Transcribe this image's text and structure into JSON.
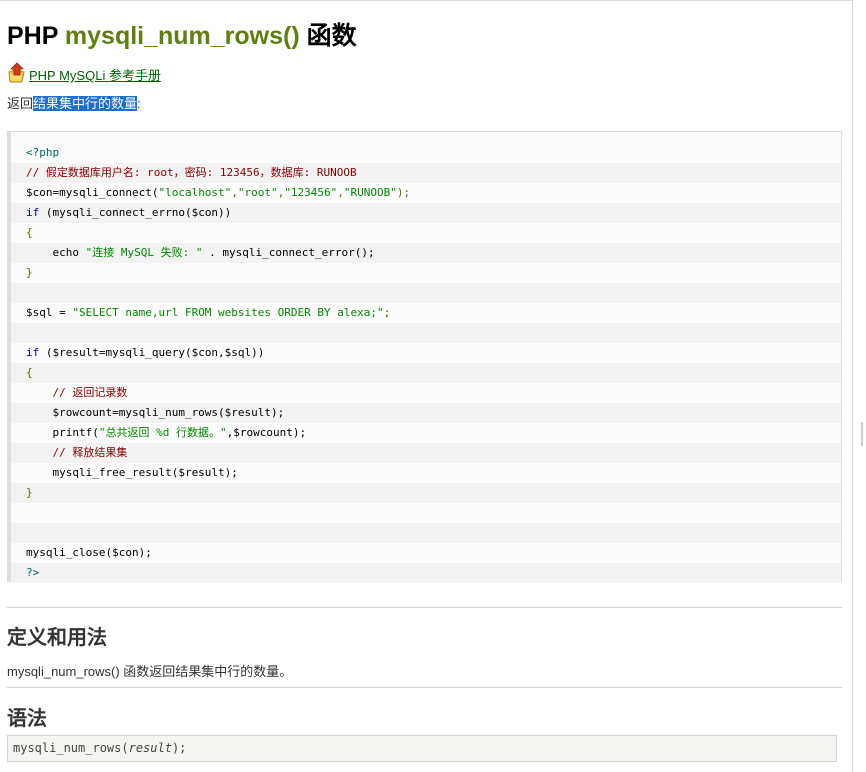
{
  "title": {
    "prefix": "PHP ",
    "function": "mysqli_num_rows()",
    "suffix": " 函数"
  },
  "reference_link": {
    "label": " PHP MySQLi 参考手册",
    "icon": "arrow-up-folder-icon"
  },
  "intro": {
    "prefix": "返回",
    "highlight": "结果集中行的数量",
    "suffix": ":"
  },
  "code_lines": [
    [
      {
        "t": "&lt;?php",
        "c": "c-tag"
      }
    ],
    [
      {
        "t": "// 假定数据库用户名: root，密码: 123456，数据库: RUNOOB",
        "c": "c-com"
      }
    ],
    [
      {
        "t": "$con=mysqli_connect(",
        "c": ""
      },
      {
        "t": "\"localhost\"",
        "c": "c-str"
      },
      {
        "t": ",",
        "c": "c-pun"
      },
      {
        "t": "\"root\"",
        "c": "c-str"
      },
      {
        "t": ",",
        "c": "c-pun"
      },
      {
        "t": "\"123456\"",
        "c": "c-str"
      },
      {
        "t": ",",
        "c": "c-pun"
      },
      {
        "t": "\"RUNOOB\"",
        "c": "c-str"
      },
      {
        "t": ");",
        "c": "c-pun"
      }
    ],
    [
      {
        "t": "if",
        "c": "c-kw"
      },
      {
        "t": " (mysqli_connect_errno($con))",
        "c": ""
      }
    ],
    [
      {
        "t": "{",
        "c": "c-pun"
      }
    ],
    [
      {
        "t": "    echo ",
        "c": ""
      },
      {
        "t": "\"连接 MySQL 失败: \"",
        "c": "c-str"
      },
      {
        "t": " . mysqli_connect_error();",
        "c": ""
      }
    ],
    [
      {
        "t": "}",
        "c": "c-pun"
      }
    ],
    [
      {
        "t": "",
        "c": ""
      }
    ],
    [
      {
        "t": "$sql = ",
        "c": ""
      },
      {
        "t": "\"SELECT name,url FROM websites ORDER BY alexa;\"",
        "c": "c-str"
      },
      {
        "t": ";",
        "c": "c-pun"
      }
    ],
    [
      {
        "t": "",
        "c": ""
      }
    ],
    [
      {
        "t": "if",
        "c": "c-kw"
      },
      {
        "t": " ($result=mysqli_query($con,$sql))",
        "c": ""
      }
    ],
    [
      {
        "t": "{",
        "c": "c-pun"
      }
    ],
    [
      {
        "t": "    ",
        "c": ""
      },
      {
        "t": "// 返回记录数",
        "c": "c-com"
      }
    ],
    [
      {
        "t": "    $rowcount=mysqli_num_rows($result);",
        "c": ""
      }
    ],
    [
      {
        "t": "    printf(",
        "c": ""
      },
      {
        "t": "\"总共返回 %d 行数据。\"",
        "c": "c-str"
      },
      {
        "t": ",$rowcount);",
        "c": ""
      }
    ],
    [
      {
        "t": "    ",
        "c": ""
      },
      {
        "t": "// 释放结果集",
        "c": "c-com"
      }
    ],
    [
      {
        "t": "    mysqli_free_result($result);",
        "c": ""
      }
    ],
    [
      {
        "t": "}",
        "c": "c-pun"
      }
    ],
    [
      {
        "t": "",
        "c": ""
      }
    ],
    [
      {
        "t": "",
        "c": ""
      }
    ],
    [
      {
        "t": "mysqli_close($con);",
        "c": ""
      }
    ],
    [
      {
        "t": "?&gt;",
        "c": "c-tag"
      }
    ]
  ],
  "definition": {
    "heading": "定义和用法",
    "text": "mysqli_num_rows() 函数返回结果集中行的数量。"
  },
  "syntax": {
    "heading": "语法",
    "code_prefix": "mysqli_num_rows(",
    "code_param": "result",
    "code_suffix": ");"
  }
}
